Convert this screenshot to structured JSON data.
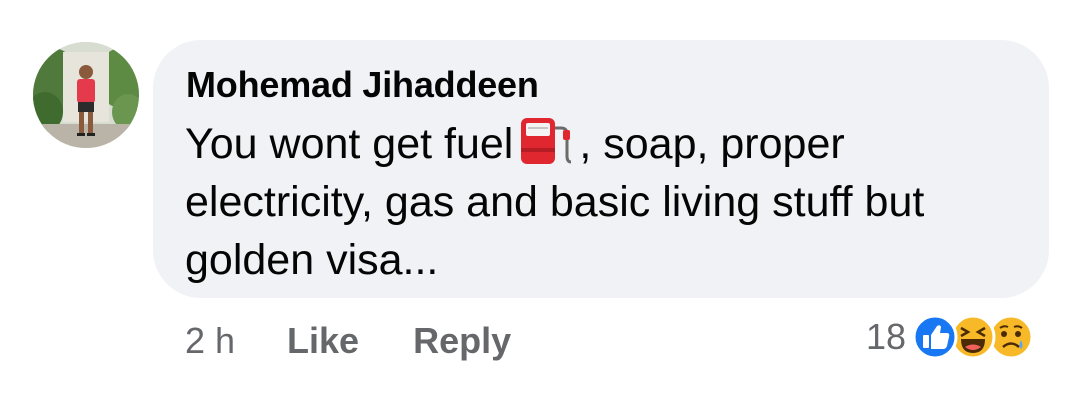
{
  "comment": {
    "author": "Mohemad Jihaddeen",
    "text_line1_before_icon": "You wont get fuel",
    "text_line1_after_icon": ", soap, proper",
    "text_rest": "electricity, gas and basic living stuff but\ngolden visa...",
    "inline_icon": "fuel-pump-icon",
    "avatar_icon": "profile-photo"
  },
  "actions": {
    "time": "2 h",
    "like_label": "Like",
    "reply_label": "Reply"
  },
  "reactions": {
    "count": "18",
    "icons": [
      "like-reaction-icon",
      "haha-reaction-icon",
      "sad-reaction-icon"
    ]
  },
  "colors": {
    "bubble": "#f0f2f5",
    "text": "#050505",
    "secondary": "#65676b",
    "like_blue": "#1877f2"
  }
}
